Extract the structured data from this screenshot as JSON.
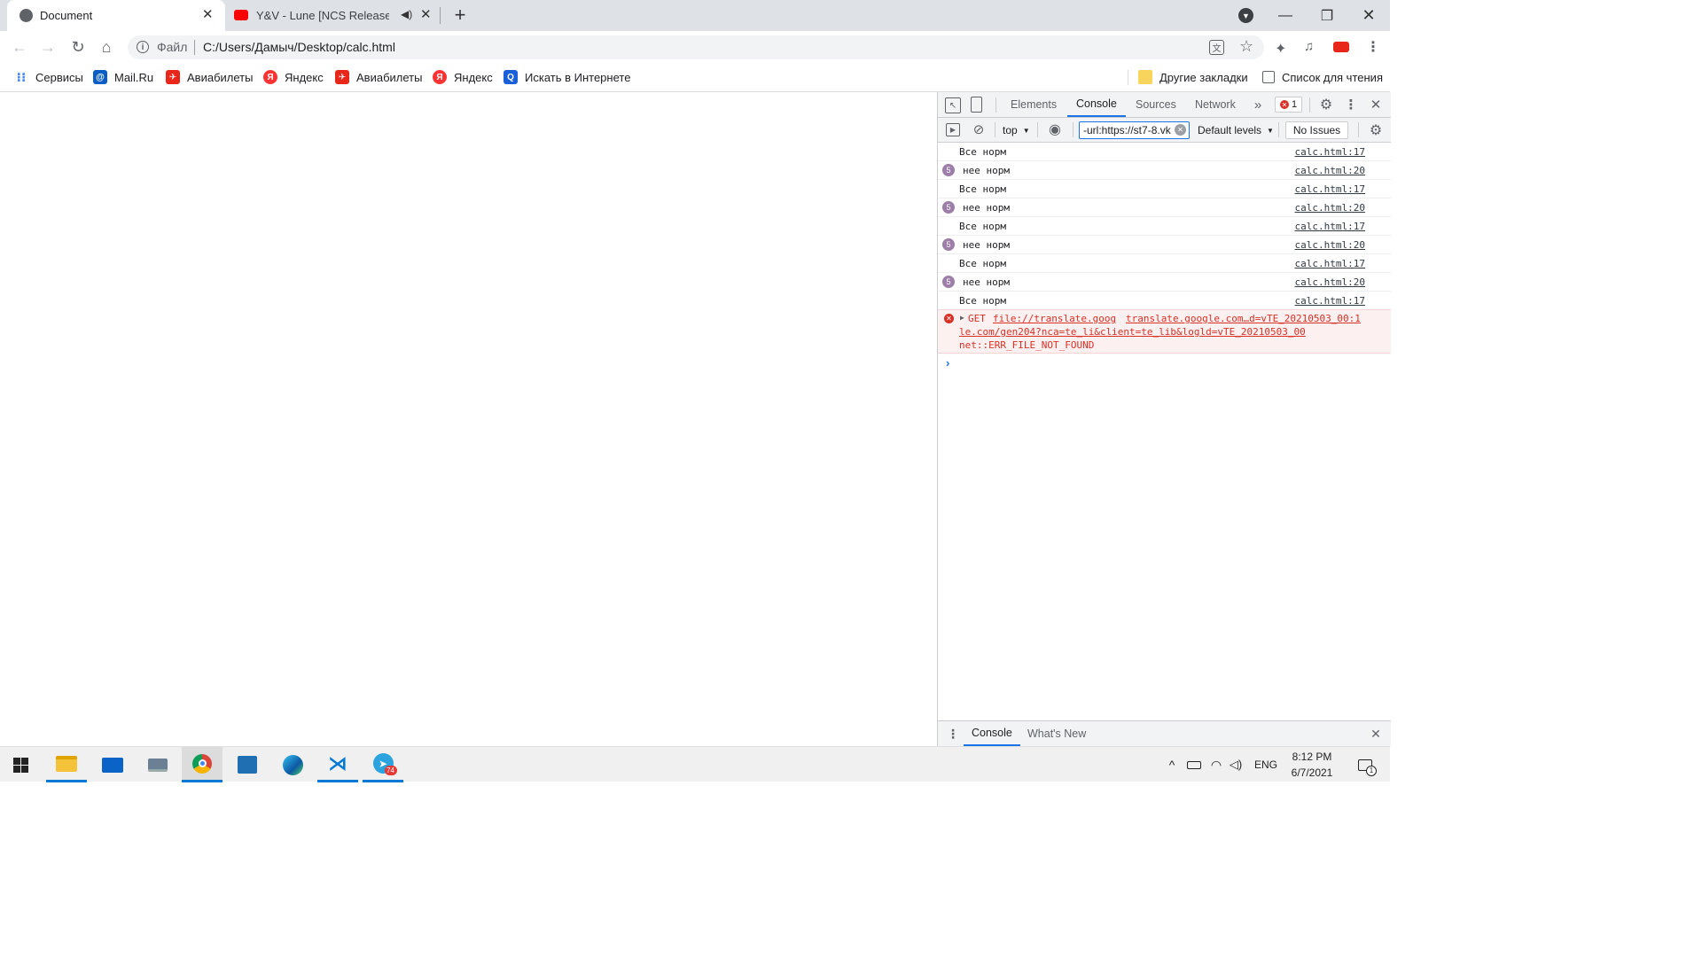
{
  "tabs": [
    {
      "title": "Document",
      "icon": "globe-icon",
      "active": true
    },
    {
      "title": "Y&V - Lune [NCS Release] - YouTube",
      "icon": "youtube-icon",
      "active": false
    }
  ],
  "toolbar": {
    "scheme_label": "Файл",
    "url": "C:/Users/Дамыч/Desktop/calc.html"
  },
  "bookmarks": [
    {
      "label": "Сервисы",
      "icon": "apps-grid-icon",
      "color": "#4285f4"
    },
    {
      "label": "Mail.Ru",
      "icon": "mailru-icon",
      "color": "#0a5dc2"
    },
    {
      "label": "Авиабилеты",
      "icon": "aviasales-icon",
      "color": "#e8261a"
    },
    {
      "label": "Яндекс",
      "icon": "yandex-icon",
      "color": "#f33"
    },
    {
      "label": "Авиабилеты",
      "icon": "aviasales-icon",
      "color": "#e8261a"
    },
    {
      "label": "Яндекс",
      "icon": "yandex-icon",
      "color": "#f33"
    },
    {
      "label": "Искать в Интернете",
      "icon": "search-icon",
      "color": "#1a5fd9"
    }
  ],
  "bookmarks_right": {
    "other": "Другие закладки",
    "reading_list": "Список для чтения"
  },
  "devtools": {
    "tabs": [
      "Elements",
      "Console",
      "Sources",
      "Network"
    ],
    "active_tab": "Console",
    "error_count": "1",
    "context": "top",
    "filter_value": "-url:https://st7-8.vk",
    "levels": "Default levels",
    "issues": "No Issues",
    "log": [
      {
        "text": "Все норм",
        "source": "calc.html:17",
        "count": ""
      },
      {
        "text": "нее норм",
        "source": "calc.html:20",
        "count": "5"
      },
      {
        "text": "Все норм",
        "source": "calc.html:17",
        "count": ""
      },
      {
        "text": "нее норм",
        "source": "calc.html:20",
        "count": "5"
      },
      {
        "text": "Все норм",
        "source": "calc.html:17",
        "count": ""
      },
      {
        "text": "нее норм",
        "source": "calc.html:20",
        "count": "5"
      },
      {
        "text": "Все норм",
        "source": "calc.html:17",
        "count": ""
      },
      {
        "text": "нее норм",
        "source": "calc.html:20",
        "count": "5"
      },
      {
        "text": "Все норм",
        "source": "calc.html:17",
        "count": ""
      }
    ],
    "error": {
      "method": "GET",
      "url_part1": "file://translate.goog",
      "url_part2": "le.com/gen204?nca=te_li&client=te_lib&logld=vTE_20210503_00",
      "source": "translate.google.com…d=vTE_20210503_00:1",
      "message": "net::ERR_FILE_NOT_FOUND"
    },
    "drawer_tabs": [
      "Console",
      "What's New"
    ]
  },
  "taskbar": {
    "apps": [
      "file-explorer-icon",
      "mail-icon",
      "laptop-icon",
      "chrome-icon",
      "photos-icon",
      "edge-icon",
      "vscode-icon",
      "telegram-icon"
    ],
    "telegram_badge": "74",
    "lang": "ENG",
    "time": "8:12 PM",
    "date": "6/7/2021",
    "notifications": "1"
  },
  "colors": {
    "accent": "#1a73e8",
    "error_red": "#d93025",
    "tab_strip": "#dee1e6"
  }
}
